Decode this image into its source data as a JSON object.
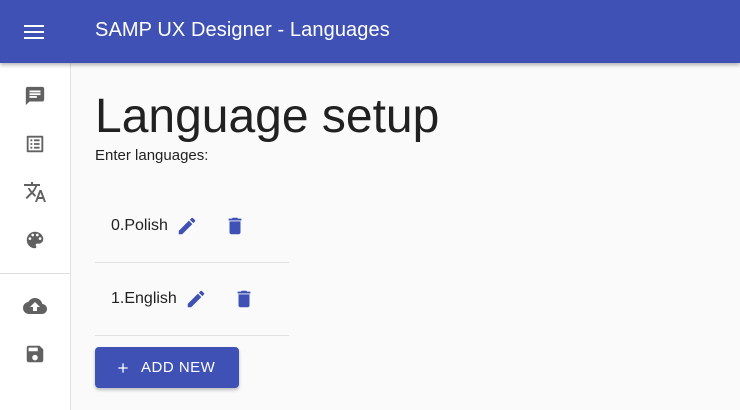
{
  "app": {
    "title": "SAMP UX Designer - Languages",
    "accent_color": "#3f51b5",
    "menu_icon": "menu-icon"
  },
  "sidebar": {
    "items": [
      {
        "icon": "chat-icon",
        "group": "top"
      },
      {
        "icon": "list-icon",
        "group": "top"
      },
      {
        "icon": "translate-icon",
        "group": "top"
      },
      {
        "icon": "palette-icon",
        "group": "top"
      },
      {
        "icon": "cloud-upload-icon",
        "group": "bottom"
      },
      {
        "icon": "save-icon",
        "group": "bottom"
      }
    ]
  },
  "main": {
    "page_title": "Language setup",
    "subtitle": "Enter languages:",
    "languages": [
      {
        "label": "0.Polish",
        "edit_icon": "pencil-icon",
        "delete_icon": "trash-icon"
      },
      {
        "label": "1.English",
        "edit_icon": "pencil-icon",
        "delete_icon": "trash-icon"
      }
    ],
    "add_button": {
      "label": "ADD NEW",
      "icon": "plus-icon"
    }
  }
}
